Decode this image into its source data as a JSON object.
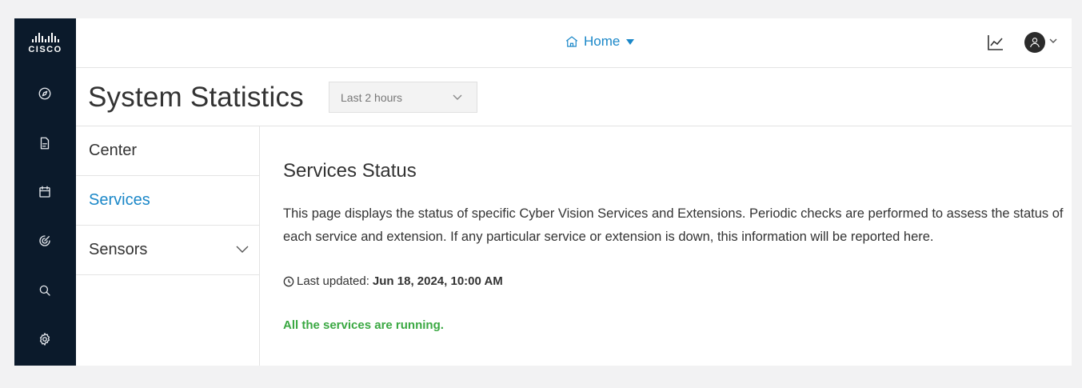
{
  "brand": {
    "logo_text": "CISCO"
  },
  "nav_rail": {
    "icons": [
      "compass-icon",
      "report-icon",
      "calendar-icon",
      "target-icon",
      "search-icon",
      "gear-icon"
    ]
  },
  "topbar": {
    "home_label": "Home",
    "icons": [
      "home-icon",
      "chart-icon",
      "user-avatar-icon"
    ]
  },
  "header": {
    "title": "System Statistics",
    "time_range": {
      "selected": "Last 2 hours"
    }
  },
  "subnav": {
    "items": [
      {
        "label": "Center",
        "active": false
      },
      {
        "label": "Services",
        "active": true
      },
      {
        "label": "Sensors",
        "active": false,
        "expandable": true
      }
    ]
  },
  "content": {
    "title": "Services Status",
    "description": "This page displays the status of specific Cyber Vision Services and Extensions. Periodic checks are performed to assess the status of each service and extension. If any particular service or extension is down, this information will be reported here.",
    "last_updated_label": "Last updated:",
    "last_updated_value": "Jun 18, 2024, 10:00 AM",
    "status_message": "All the services are running."
  },
  "colors": {
    "rail_bg": "#0b1a2b",
    "accent": "#1a87c8",
    "success": "#3aa842"
  }
}
